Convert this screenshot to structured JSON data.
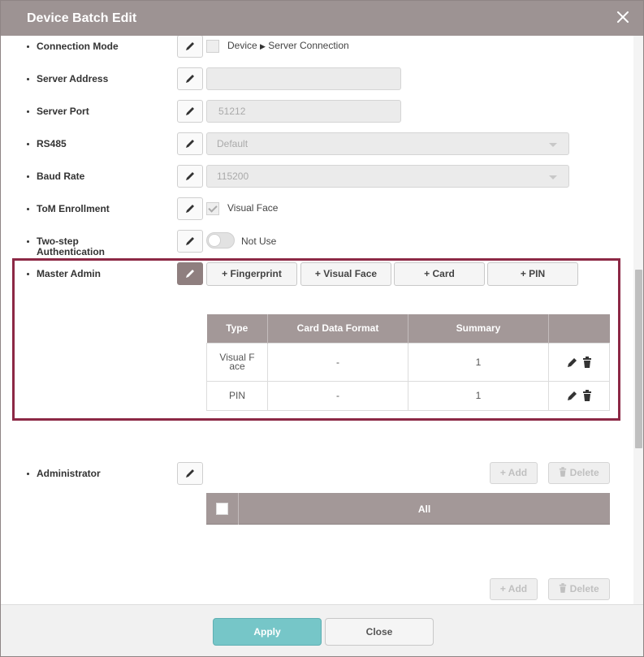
{
  "dialog": {
    "title": "Device Batch Edit"
  },
  "fields": {
    "connection_mode": {
      "label": "Connection Mode",
      "option_prefix": "Device",
      "option_suffix": "Server Connection"
    },
    "server_address": {
      "label": "Server Address",
      "value": ""
    },
    "server_port": {
      "label": "Server Port",
      "value": "51212"
    },
    "rs485": {
      "label": "RS485",
      "value": "Default"
    },
    "baud_rate": {
      "label": "Baud Rate",
      "value": "115200"
    },
    "tom_enrollment": {
      "label": "ToM Enrollment",
      "option": "Visual Face"
    },
    "two_step": {
      "label_line1": "Two-step",
      "label_line2": "Authentication",
      "value": "Not Use"
    },
    "master_admin": {
      "label": "Master Admin"
    },
    "administrator": {
      "label": "Administrator"
    }
  },
  "credential_buttons": {
    "fingerprint": "+ Fingerprint",
    "visual_face": "+ Visual Face",
    "card": "+ Card",
    "pin": "+ PIN"
  },
  "master_table": {
    "headers": [
      "Type",
      "Card Data Format",
      "Summary",
      ""
    ],
    "rows": [
      {
        "type_line1": "Visual F",
        "type_line2": "ace",
        "format": "-",
        "summary": "1"
      },
      {
        "type": "PIN",
        "format": "-",
        "summary": "1"
      }
    ]
  },
  "admin_actions": {
    "add": "+ Add",
    "delete": "Delete"
  },
  "admin_table": {
    "header": "All"
  },
  "footer": {
    "apply": "Apply",
    "close": "Close"
  }
}
